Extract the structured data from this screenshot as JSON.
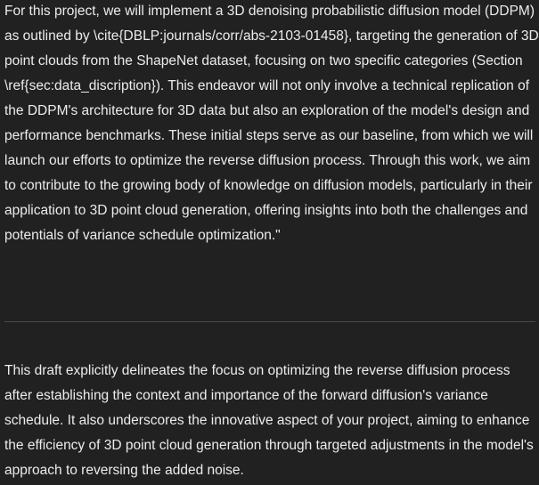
{
  "message": {
    "paragraph_1": "For this project, we will implement a 3D denoising probabilistic diffusion model (DDPM) as outlined by \\cite{DBLP:journals/corr/abs-2103-01458}, targeting the generation of 3D point clouds from the ShapeNet dataset, focusing on two specific categories (Section \\ref{sec:data_discription}). This endeavor will not only involve a technical replication of the DDPM's architecture for 3D data but also an exploration of the model's design and performance benchmarks. These initial steps serve as our baseline, from which we will launch our efforts to optimize the reverse diffusion process. Through this work, we aim to contribute to the growing body of knowledge on diffusion models, particularly in their application to 3D point cloud generation, offering insights into both the challenges and potentials of variance schedule optimization.\"",
    "paragraph_2": "This draft explicitly delineates the focus on optimizing the reverse diffusion process after establishing the context and importance of the forward diffusion's variance schedule. It also underscores the innovative aspect of your project, aiming to enhance the efficiency of 3D point cloud generation through targeted adjustments in the model's approach to reversing the added noise."
  },
  "colors": {
    "background": "#212121",
    "text": "#ececec",
    "divider": "#4a4a4a"
  }
}
